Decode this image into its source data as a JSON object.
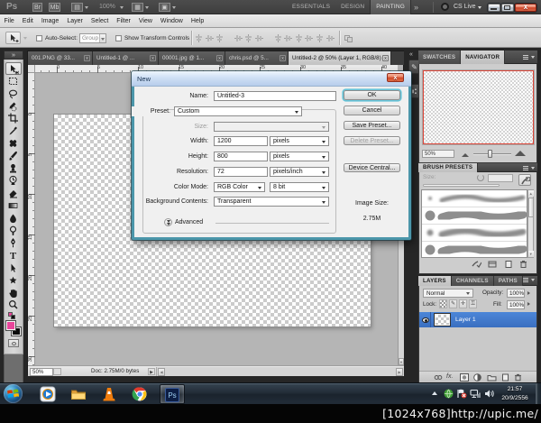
{
  "colors": {
    "foreground_swatch": "#e8459a",
    "selection_blue": "#3a6fc0",
    "navigator_view_border": "#dc4538",
    "close_button_red": "#d14a28",
    "dialog_border_teal": "#4b96aa"
  },
  "titlebar": {
    "logo": "Ps",
    "zoom_level": "100%",
    "workspaces": [
      "ESSENTIALS",
      "DESIGN",
      "PAINTING"
    ],
    "active_workspace": "PAINTING",
    "overflow": "»",
    "cs_live_label": "CS Live",
    "close_glyph": "x"
  },
  "menubar": {
    "items": [
      "File",
      "Edit",
      "Image",
      "Layer",
      "Select",
      "Filter",
      "View",
      "Window",
      "Help"
    ]
  },
  "options_bar": {
    "auto_select_label": "Auto-Select:",
    "auto_select_value": "Group",
    "show_transform_label": "Show Transform Controls"
  },
  "tool_dock": {
    "collapse_glyph": "»",
    "tools": [
      {
        "name": "move",
        "selected": true
      },
      {
        "name": "rectangular-marquee"
      },
      {
        "name": "lasso"
      },
      {
        "name": "quick-selection"
      },
      {
        "name": "crop"
      },
      {
        "name": "eyedropper"
      },
      {
        "name": "spot-healing-brush"
      },
      {
        "name": "brush"
      },
      {
        "name": "clone-stamp"
      },
      {
        "name": "history-brush"
      },
      {
        "name": "eraser"
      },
      {
        "name": "gradient"
      },
      {
        "name": "blur"
      },
      {
        "name": "dodge"
      },
      {
        "name": "pen"
      },
      {
        "name": "type"
      },
      {
        "name": "path-selection"
      },
      {
        "name": "custom-shape"
      },
      {
        "name": "hand"
      },
      {
        "name": "zoom"
      }
    ]
  },
  "document_tabs": [
    {
      "label": "001.PNG @ 33...",
      "close": "x"
    },
    {
      "label": "Untitled-1 @ ...",
      "close": "x"
    },
    {
      "label": "00001.jpg @ 1...",
      "close": "x"
    },
    {
      "label": "chris.psd @ 5...",
      "close": "x"
    },
    {
      "label": "Untitled-2 @ 50% (Layer 1, RGB/8)",
      "close": "x",
      "active": true
    }
  ],
  "rulers": {
    "horizontal_labels": [
      "0",
      "5",
      "10",
      "15",
      "20",
      "25",
      "30",
      "35",
      "40"
    ],
    "vertical_labels": [
      "0",
      "5",
      "10",
      "15",
      "20",
      "25",
      "30"
    ]
  },
  "status_bar": {
    "zoom": "50%",
    "doc_info": "Doc: 2.75M/0 bytes"
  },
  "dialog": {
    "title": "New",
    "close_glyph": "x",
    "name_label": "Name:",
    "name_value": "Untitled-3",
    "preset_label": "Preset:",
    "preset_value": "Custom",
    "size_label": "Size:",
    "width_label": "Width:",
    "width_value": "1200",
    "width_unit": "pixels",
    "height_label": "Height:",
    "height_value": "800",
    "height_unit": "pixels",
    "resolution_label": "Resolution:",
    "resolution_value": "72",
    "resolution_unit": "pixels/inch",
    "color_mode_label": "Color Mode:",
    "color_mode_value": "RGB Color",
    "bit_depth_value": "8 bit",
    "background_label": "Background Contents:",
    "background_value": "Transparent",
    "advanced_label": "Advanced",
    "ok_label": "OK",
    "cancel_label": "Cancel",
    "save_preset_label": "Save Preset...",
    "delete_preset_label": "Delete Preset...",
    "device_central_label": "Device Central...",
    "image_size_label": "Image Size:",
    "image_size_value": "2.75M"
  },
  "panels": {
    "dock_collapse": "«",
    "navigator": {
      "tabs": [
        "SWATCHES",
        "NAVIGATOR"
      ],
      "active_tab": "NAVIGATOR",
      "zoom_value": "50%"
    },
    "brush_presets": {
      "title": "BRUSH PRESETS",
      "size_label": "Size:",
      "brushes": [
        {
          "tip": 4,
          "soft": true,
          "stroke": 5
        },
        {
          "tip": 11,
          "soft": false,
          "stroke": 9
        },
        {
          "tip": 7,
          "soft": true,
          "stroke": 7
        },
        {
          "tip": 11,
          "soft": false,
          "stroke": 9
        }
      ]
    },
    "layers": {
      "tabs": [
        "LAYERS",
        "CHANNELS",
        "PATHS"
      ],
      "active_tab": "LAYERS",
      "blend_mode": "Normal",
      "opacity_label": "Opacity:",
      "opacity_value": "100%",
      "lock_label": "Lock:",
      "fill_label": "Fill:",
      "fill_value": "100%",
      "layer_name": "Layer 1"
    }
  },
  "taskbar": {
    "clock_time": "21:57",
    "clock_date": "20/9/2556"
  },
  "watermark": {
    "text": "[1024x768]http://upic.me/"
  }
}
